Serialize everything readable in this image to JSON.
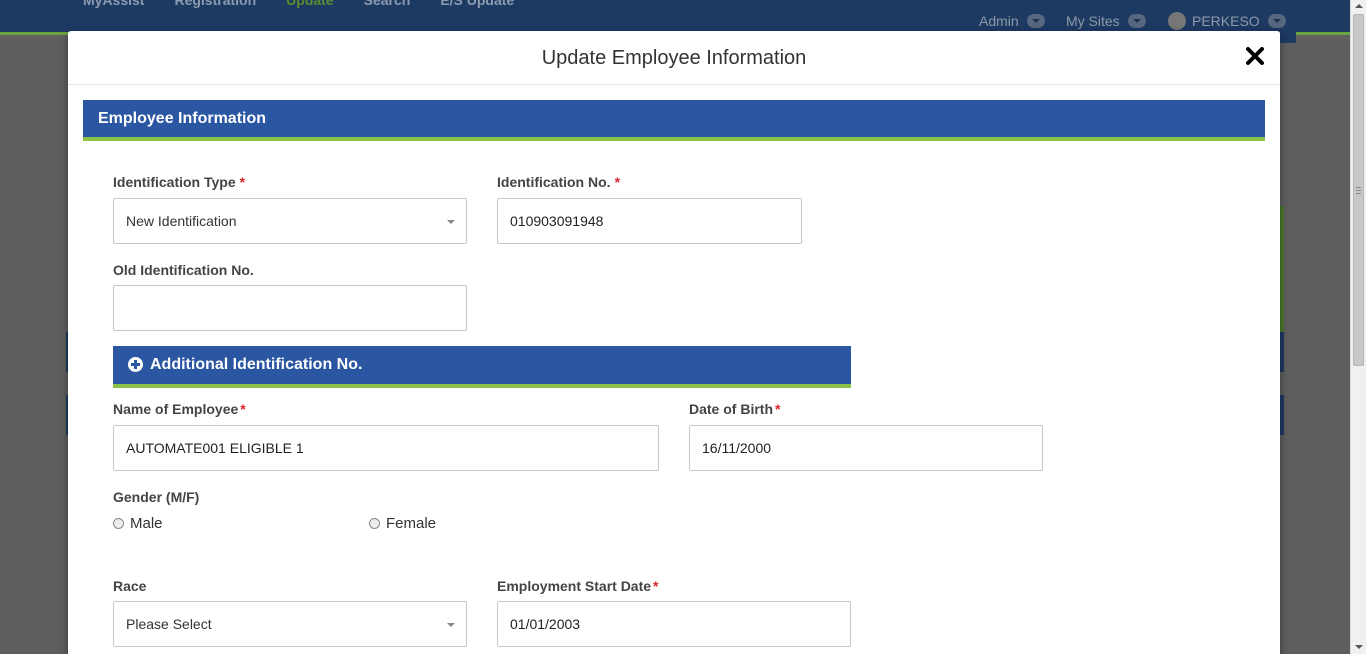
{
  "background": {
    "nav_items": [
      "MyAssist",
      "Registration",
      "Update",
      "Search",
      "E/S Update"
    ],
    "admin_label": "Admin",
    "sites_label": "My Sites",
    "user_label": "PERKESO"
  },
  "modal": {
    "title": "Update Employee Information",
    "section_title": "Employee Information",
    "additional_title": "Additional Identification No."
  },
  "form": {
    "identification_type": {
      "label": "Identification Type",
      "value": "New Identification"
    },
    "identification_no": {
      "label": "Identification No.",
      "value": "010903091948"
    },
    "old_identification_no": {
      "label": "Old Identification No.",
      "value": ""
    },
    "name_of_employee": {
      "label": "Name of Employee",
      "value": "AUTOMATE001 ELIGIBLE 1"
    },
    "date_of_birth": {
      "label": "Date of Birth",
      "value": "16/11/2000"
    },
    "gender": {
      "label": "Gender (M/F)",
      "options": [
        "Male",
        "Female"
      ],
      "selected": null
    },
    "race": {
      "label": "Race",
      "value": "Please Select"
    },
    "employment_start_date": {
      "label": "Employment Start Date",
      "value": "01/01/2003"
    },
    "required_marker": "*"
  }
}
